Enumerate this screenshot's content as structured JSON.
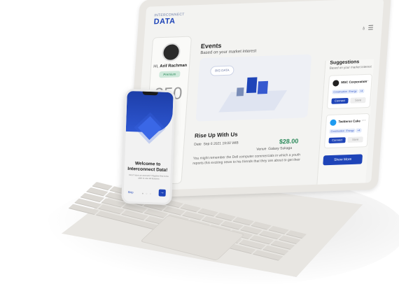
{
  "brand": {
    "logo_text": "DATA",
    "logo_kicker": "INTERCONNECT"
  },
  "profile": {
    "greeting": "Hi,",
    "name": "Arif Rachman",
    "badge": "Premium",
    "big_number": "350"
  },
  "events": {
    "title": "Events",
    "subtitle": "Based on your market interest",
    "cloud_label": "BIG DATA",
    "event_title": "Rise Up With Us",
    "price": "$28.00",
    "date_label": "Date",
    "date": "Sep 6 2021 19:00 WIB",
    "venue_label": "Venue",
    "venue": "Galaxy Sukaga",
    "description": "You might remember the Dell computer commercials in which a youth reports this exciting news to his friends that they are about to get their"
  },
  "suggestions": {
    "title": "Suggestions",
    "subtitle": "Based on your market interest",
    "items": [
      {
        "name": "MSC Corporation",
        "tags": [
          "Construction",
          "Energy",
          "+4"
        ],
        "connect": "Connect",
        "save": "Save"
      },
      {
        "name": "Twitterss Cake",
        "tags": [
          "Construction",
          "Energy",
          "+4"
        ],
        "connect": "Connect",
        "save": "Save"
      }
    ],
    "show_more": "Show More"
  },
  "phone": {
    "title": "Welcome to Interconnect Data!",
    "description": "Don't have an account? Register first to be able to use all features",
    "skip": "Skip",
    "next_icon": "arrow-right-icon"
  },
  "colors": {
    "brand": "#1e44b8",
    "accent_green": "#2d8a5b",
    "twitter": "#1e9bf0"
  }
}
